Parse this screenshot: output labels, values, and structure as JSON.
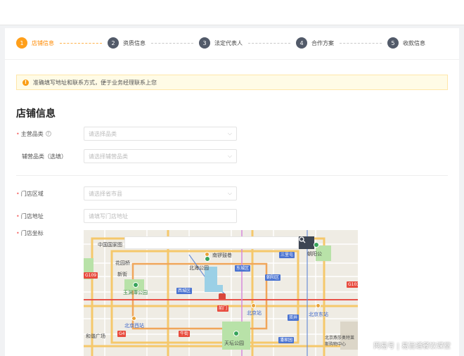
{
  "steps": [
    {
      "number": "1",
      "label": "店铺信息",
      "active": true
    },
    {
      "number": "2",
      "label": "资质信息"
    },
    {
      "number": "3",
      "label": "法定代表人"
    },
    {
      "number": "4",
      "label": "合作方案"
    },
    {
      "number": "5",
      "label": "收款信息"
    }
  ],
  "notice": {
    "icon": "info-icon",
    "text": "准确填写地址和联系方式，便于业务经理联系上您"
  },
  "section_title": "店铺信息",
  "form": {
    "main_category": {
      "label": "主营品类",
      "required": true,
      "placeholder": "请选择品类"
    },
    "secondary_category": {
      "label": "辅营品类（选填）",
      "placeholder": "请选择辅营品类"
    },
    "region": {
      "label": "门店区域",
      "required": true,
      "placeholder": "请选择省市县"
    },
    "address": {
      "label": "门店地址",
      "required": true,
      "placeholder": "请填写门店地址"
    },
    "coords": {
      "label": "门店坐标",
      "required": true
    }
  },
  "map": {
    "search_icon": "search-icon",
    "labels": {
      "guojia_tushuguan": "中国国家图",
      "nanluoguxiang": "南锣鼓巷",
      "sanlitun": "三里屯",
      "chaoyang_park": "朝阳公",
      "huayuan": "花园桥",
      "xinjiekou": "新街",
      "beihai": "北海公园",
      "dongcheng": "东城区",
      "chaoyang_district": "朝阳区",
      "yuyuantan": "玉渊潭公园",
      "xicheng": "西城区",
      "qianmen": "前门",
      "beijing_station": "北京站",
      "beijing_east": "北京东站",
      "beijing_west": "北京西站",
      "niujie": "牛街",
      "shuangjing": "双井",
      "tiantan": "天坛公园",
      "panjiayuan": "潘家园",
      "chaoyang_mall": "北京燕莎奥特莱斯购物中心",
      "yuntai": "和谐广场",
      "g109": "G109",
      "g4": "G4",
      "g103": "G103"
    }
  },
  "watermark": "网易号 | 易旨通餐饮课堂",
  "colors": {
    "accent": "#ff9f1a",
    "step_inactive": "#525a69",
    "notice_bg": "#fffbe6"
  }
}
